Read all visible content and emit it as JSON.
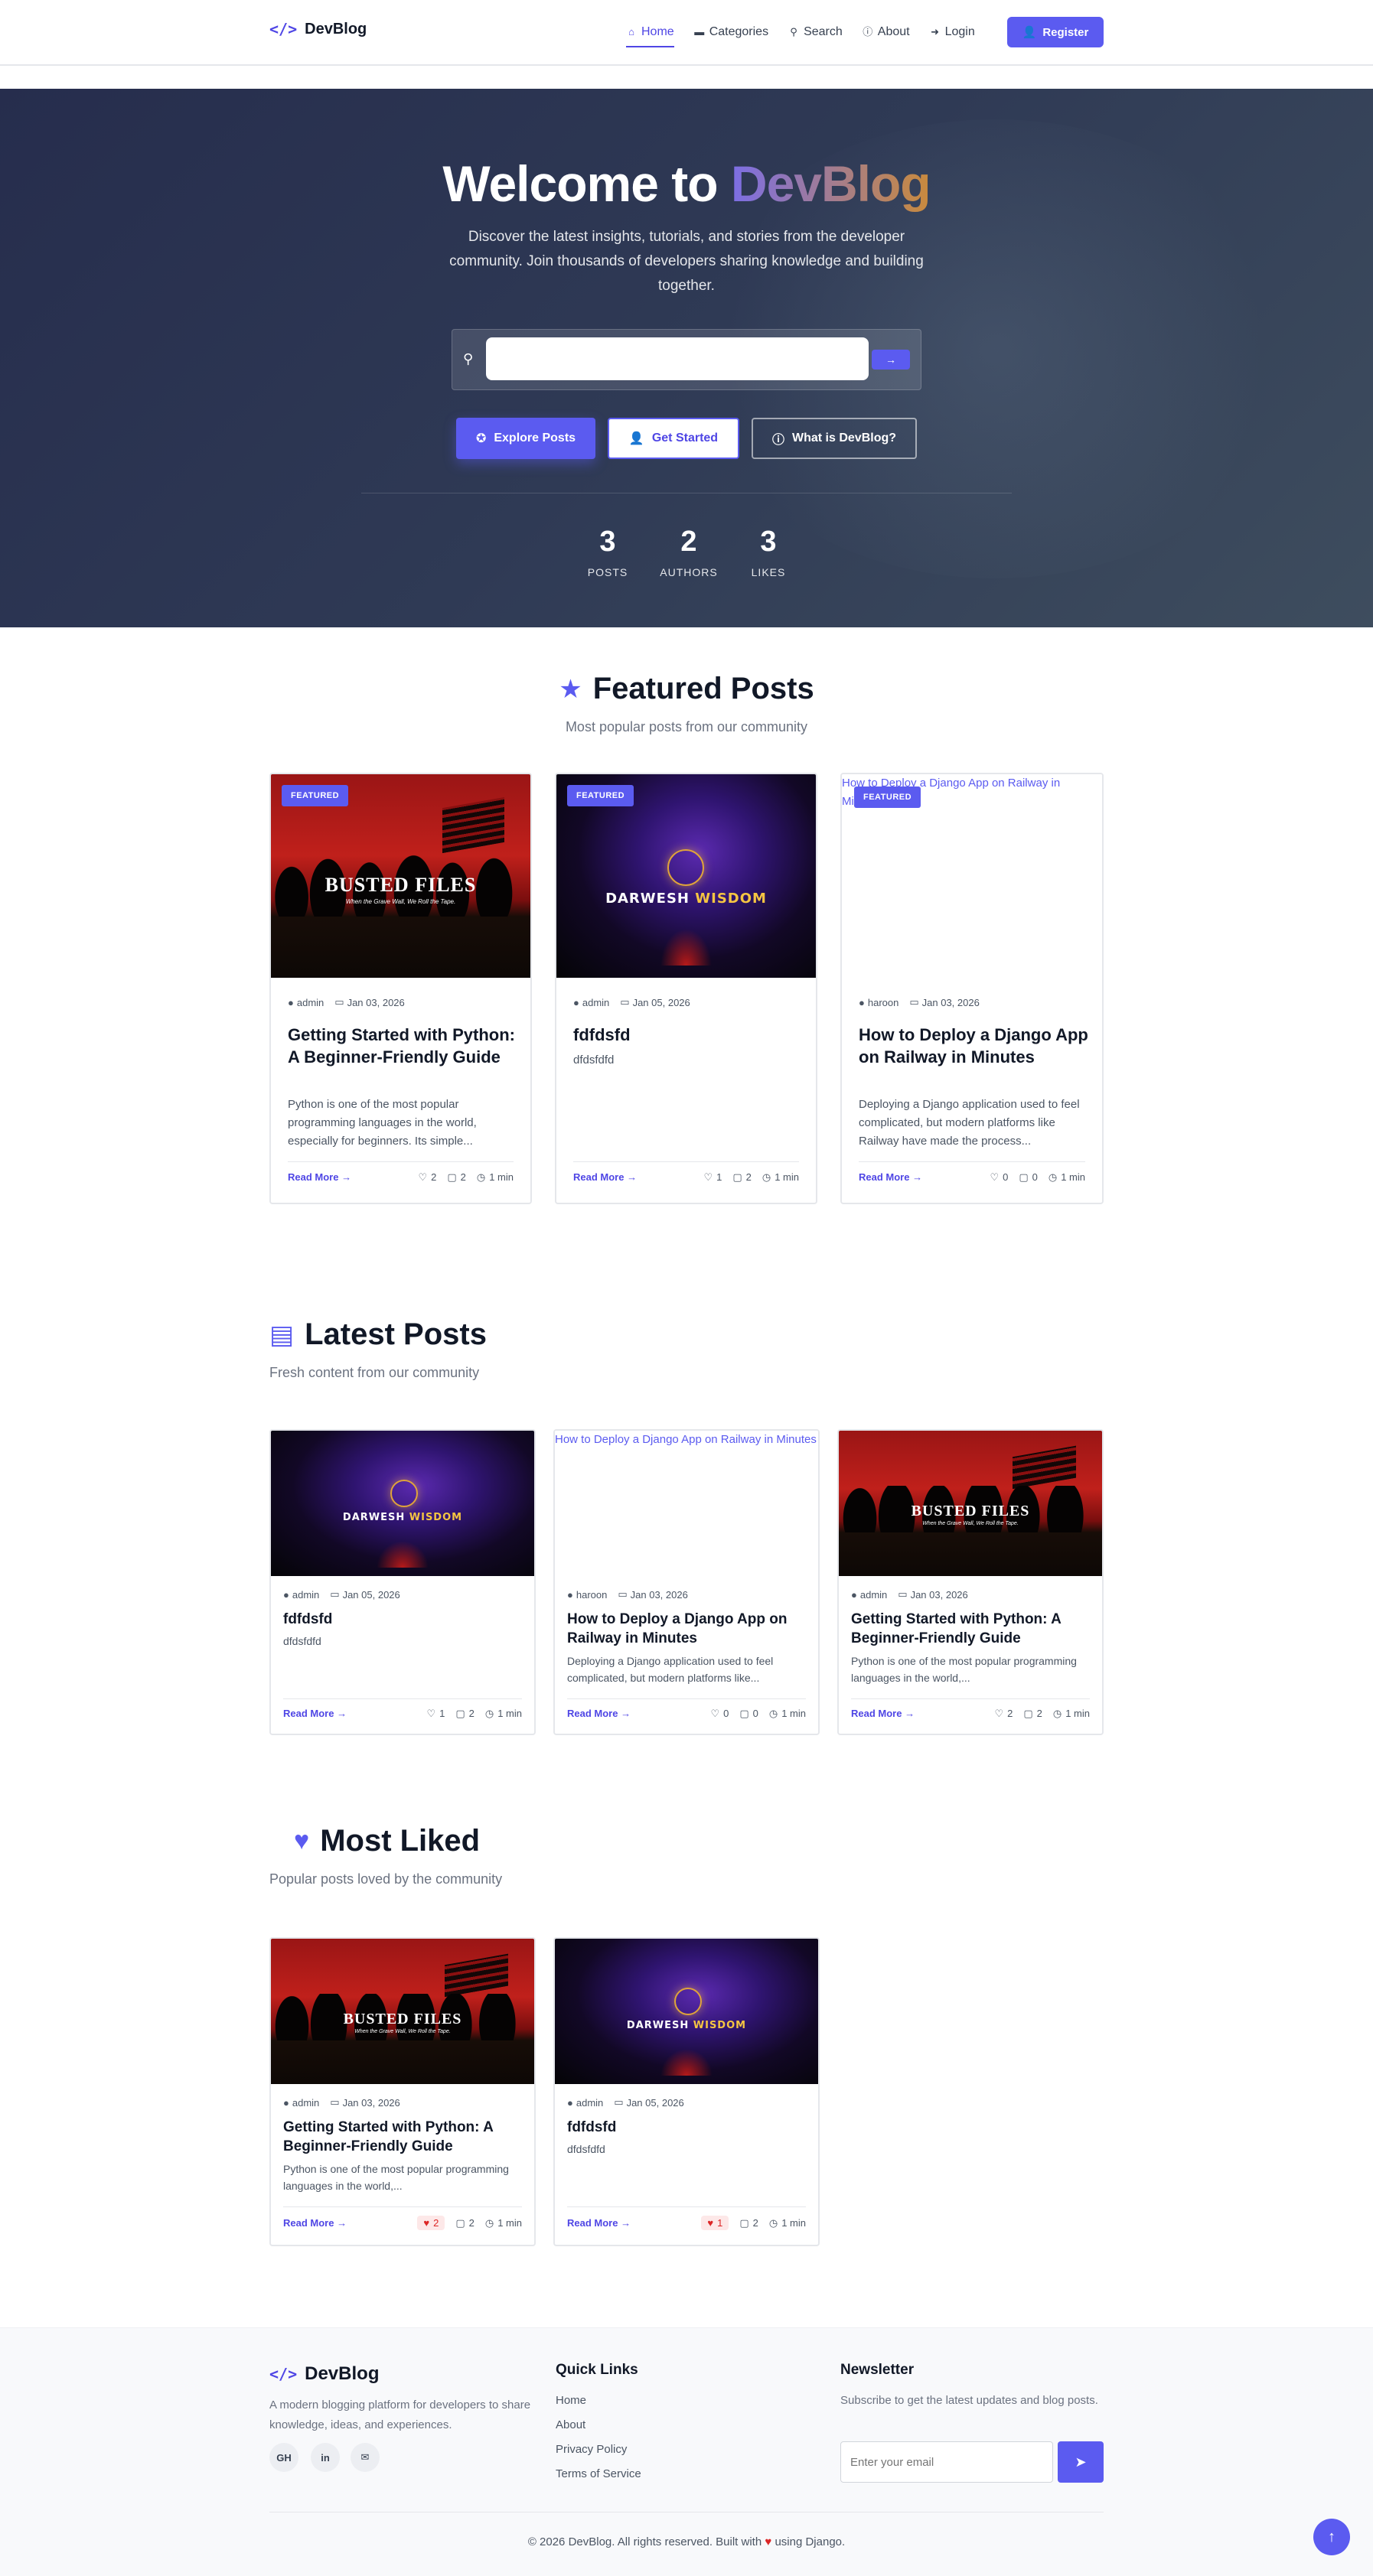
{
  "nav": {
    "brand": "DevBlog",
    "brand_icon": "</>",
    "links": [
      {
        "label": "Home",
        "icon": "home-icon",
        "glyph": "⌂"
      },
      {
        "label": "Categories",
        "icon": "folder-icon",
        "glyph": "▬"
      },
      {
        "label": "Search",
        "icon": "search-icon",
        "glyph": "⚲"
      },
      {
        "label": "About",
        "icon": "info-icon",
        "glyph": "ⓘ"
      },
      {
        "label": "Login",
        "icon": "sign-in-icon",
        "glyph": "➜"
      }
    ],
    "register": "Register"
  },
  "hero": {
    "title_prefix": "Welcome to ",
    "title_brand": "DevBlog",
    "subtitle": "Discover the latest insights, tutorials, and stories from the developer community. Join thousands of developers sharing knowledge and building together.",
    "search_placeholder": "",
    "buttons": [
      "Explore Posts",
      "Get Started",
      "What is DevBlog?"
    ],
    "stats": [
      {
        "num": "3",
        "label": "POSTS"
      },
      {
        "num": "2",
        "label": "AUTHORS"
      },
      {
        "num": "3",
        "label": "LIKES"
      }
    ]
  },
  "featured": {
    "title": "Featured Posts",
    "subtitle": "Most popular posts from our community",
    "badge": "FEATURED",
    "read_more": "Read More →",
    "cards": [
      {
        "author": "admin",
        "date": "Jan 03, 2026",
        "title": "Getting Started with Python: A Beginner-Friendly Guide",
        "excerpt": "Python is one of the most popular programming languages in the world, especially for beginners. Its simple...",
        "likes": "2",
        "comments": "2",
        "read": "1 min"
      },
      {
        "author": "admin",
        "date": "Jan 05, 2026",
        "title": "fdfdsfd",
        "excerpt": "dfdsfdfd",
        "likes": "1",
        "comments": "2",
        "read": "1 min"
      },
      {
        "author": "haroon",
        "date": "Jan 03, 2026",
        "title": "How to Deploy a Django App on Railway in Minutes",
        "excerpt": "Deploying a Django application used to feel complicated, but modern platforms like Railway have made the process...",
        "likes": "0",
        "comments": "0",
        "read": "1 min",
        "alt": "How to Deploy a Django App on Railway in Minutes"
      }
    ]
  },
  "latest": {
    "title": "Latest Posts",
    "subtitle": "Fresh content from our community",
    "read_more": "Read More →",
    "cards": [
      {
        "author": "admin",
        "date": "Jan 05, 2026",
        "title": "fdfdsfd",
        "excerpt": "dfdsfdfd",
        "likes": "1",
        "comments": "2",
        "read": "1 min"
      },
      {
        "author": "haroon",
        "date": "Jan 03, 2026",
        "title": "How to Deploy a Django App on Railway in Minutes",
        "excerpt": "Deploying a Django application used to feel complicated, but modern platforms like...",
        "likes": "0",
        "comments": "0",
        "read": "1 min",
        "alt": "How to Deploy a Django App on Railway in Minutes"
      },
      {
        "author": "admin",
        "date": "Jan 03, 2026",
        "title": "Getting Started with Python: A Beginner-Friendly Guide",
        "excerpt": "Python is one of the most popular programming languages in the world,...",
        "likes": "2",
        "comments": "2",
        "read": "1 min"
      }
    ]
  },
  "liked": {
    "title": "Most Liked",
    "subtitle": "Popular posts loved by the community",
    "read_more": "Read More →",
    "cards": [
      {
        "author": "admin",
        "date": "Jan 03, 2026",
        "title": "Getting Started with Python: A Beginner-Friendly Guide",
        "excerpt": "Python is one of the most popular programming languages in the world,...",
        "likes": "2",
        "comments": "2",
        "read": "1 min"
      },
      {
        "author": "admin",
        "date": "Jan 05, 2026",
        "title": "fdfdsfd",
        "excerpt": "dfdsfdfd",
        "likes": "1",
        "comments": "2",
        "read": "1 min"
      }
    ]
  },
  "thumbs": {
    "busted_title": "BUSTED FILES",
    "busted_tag": "When the Grave Wall, We Roll the Tape.",
    "darwesh_w1": "DARWESH",
    "darwesh_w2": "WISDOM"
  },
  "footer": {
    "brand": "DevBlog",
    "desc": "A modern blogging platform for developers to share knowledge, ideas, and experiences.",
    "social": [
      "GH",
      "in",
      "✉"
    ],
    "quick_title": "Quick Links",
    "quick_links": [
      "Home",
      "About",
      "Privacy Policy",
      "Terms of Service"
    ],
    "news_title": "Newsletter",
    "news_desc": "Subscribe to get the latest updates and blog posts.",
    "email_placeholder": "Enter your email",
    "copy_a": "© 2026 DevBlog. All rights reserved. Built with",
    "copy_b": "using Django."
  },
  "colors": {
    "accent": "#5b5bf0",
    "hero_bg": "#2b3450",
    "heart": "#dc2626"
  }
}
